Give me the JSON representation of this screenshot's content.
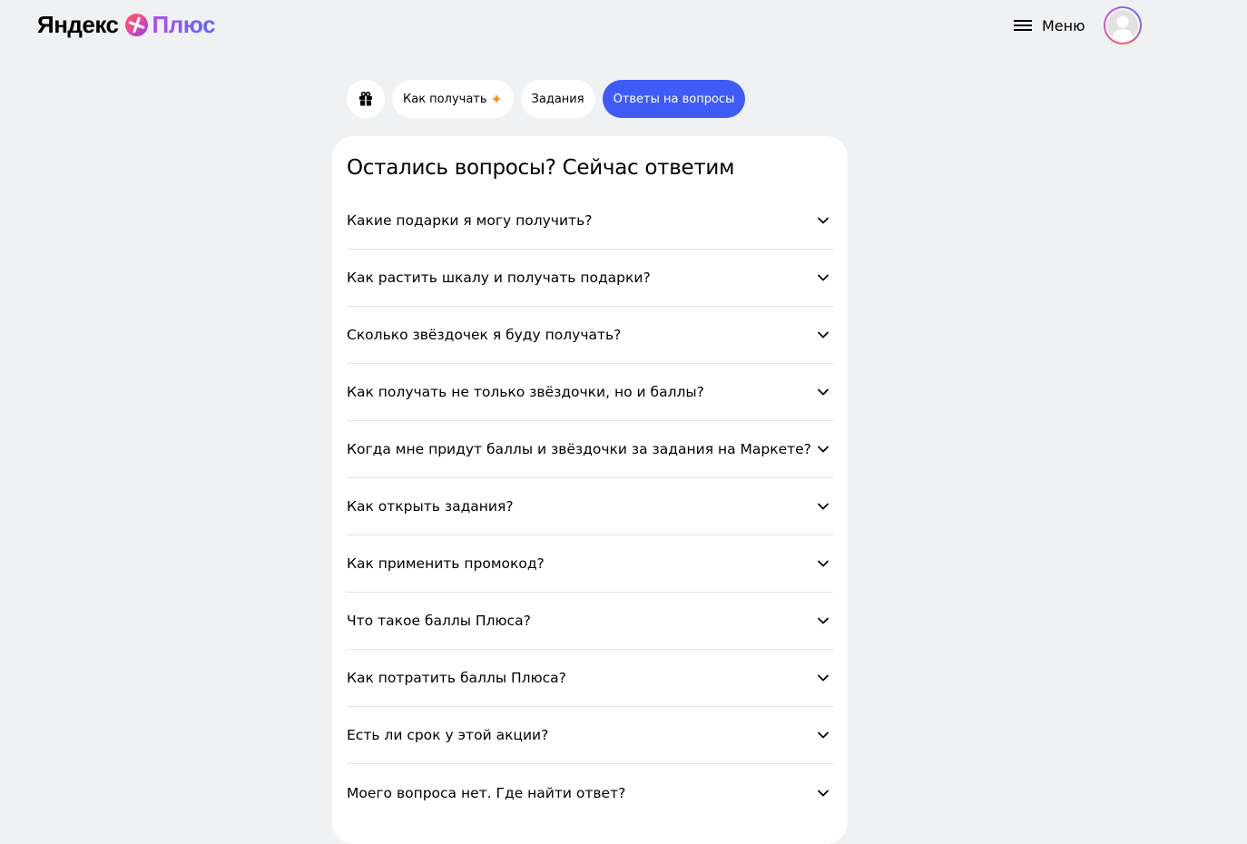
{
  "header": {
    "logo_brand": "Яндекс",
    "logo_product": "Плюс",
    "menu_label": "Меню"
  },
  "tabs": [
    {
      "label": "",
      "icon": "gift-icon"
    },
    {
      "label": "Как получать",
      "icon": "star-icon"
    },
    {
      "label": "Задания"
    },
    {
      "label": "Ответы на вопросы",
      "active": true
    }
  ],
  "faq": {
    "title": "Остались вопросы? Сейчас ответим",
    "items": [
      "Какие подарки я могу получить?",
      "Как растить шкалу и получать подарки?",
      "Сколько звёздочек я буду получать?",
      "Как получать не только звёздочки, но и баллы?",
      "Когда мне придут баллы и звёздочки за задания на Маркете?",
      "Как открыть задания?",
      "Как применить промокод?",
      "Что такое баллы Плюса?",
      "Как потратить баллы Плюса?",
      "Есть ли срок у этой акции?",
      "Моего вопроса нет. Где найти ответ?"
    ]
  },
  "colors": {
    "background": "#f0f1f3",
    "accent": "#3e5cf5",
    "card": "#ffffff"
  }
}
